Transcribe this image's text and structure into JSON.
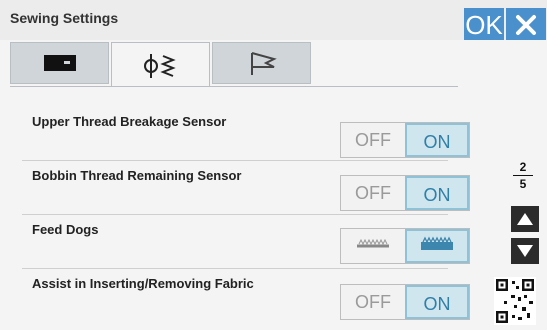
{
  "header": {
    "title": "Sewing Settings",
    "ok_label": "OK"
  },
  "tabs": [
    {
      "icon": "sewing-machine-icon",
      "active": false
    },
    {
      "icon": "stitch-needle-icon",
      "active": true
    },
    {
      "icon": "flag-icon",
      "active": false
    }
  ],
  "settings": [
    {
      "label": "Upper Thread Breakage Sensor",
      "off": "OFF",
      "on": "ON",
      "value": "ON"
    },
    {
      "label": "Bobbin Thread Remaining Sensor",
      "off": "OFF",
      "on": "ON",
      "value": "ON"
    },
    {
      "label": "Feed Dogs",
      "value": "raised"
    },
    {
      "label": "Assist in Inserting/Removing Fabric",
      "off": "OFF",
      "on": "ON",
      "value": "ON"
    }
  ],
  "pager": {
    "current": "2",
    "total": "5"
  },
  "colors": {
    "accent": "#4a90cc",
    "on_bg": "#cfe6ee",
    "on_text": "#2f7fa9"
  }
}
